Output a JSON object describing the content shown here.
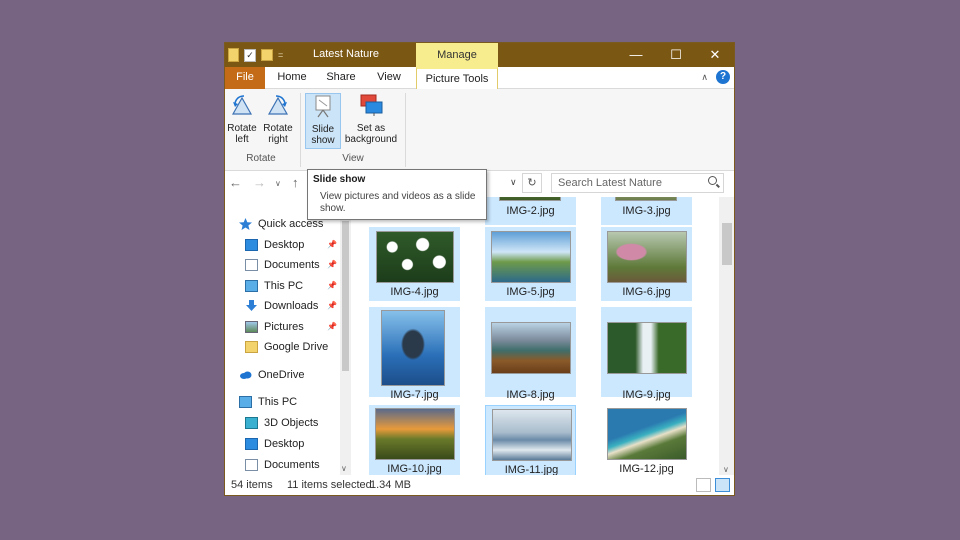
{
  "window": {
    "title": "Latest Nature"
  },
  "titlebar": {
    "manage_label": "Manage",
    "minimize": "—",
    "maximize": "☐",
    "close": "✕",
    "sep": "="
  },
  "tabs": {
    "file": "File",
    "home": "Home",
    "share": "Share",
    "view": "View",
    "picture_tools": "Picture Tools"
  },
  "ribbon": {
    "rotate_left": [
      "Rotate",
      "left"
    ],
    "rotate_right": [
      "Rotate",
      "right"
    ],
    "slide_show": [
      "Slide",
      "show"
    ],
    "set_background": [
      "Set as",
      "background"
    ],
    "group_rotate": "Rotate",
    "group_view": "View"
  },
  "tooltip": {
    "title": "Slide show",
    "text": "View pictures and videos as a slide show."
  },
  "address": {
    "search_placeholder": "Search Latest Nature"
  },
  "nav": {
    "quick_access": "Quick access",
    "desktop": "Desktop",
    "documents": "Documents",
    "this_pc_qa": "This PC",
    "downloads": "Downloads",
    "pictures": "Pictures",
    "google_drive": "Google Drive",
    "onedrive": "OneDrive",
    "this_pc": "This PC",
    "objects_3d": "3D Objects",
    "desktop2": "Desktop",
    "documents2": "Documents"
  },
  "files": [
    {
      "name": "IMG-2.jpg",
      "selected": true
    },
    {
      "name": "IMG-3.jpg",
      "selected": true
    },
    {
      "name": "IMG-4.jpg",
      "selected": true
    },
    {
      "name": "IMG-5.jpg",
      "selected": true
    },
    {
      "name": "IMG-6.jpg",
      "selected": true
    },
    {
      "name": "IMG-7.jpg",
      "selected": true
    },
    {
      "name": "IMG-8.jpg",
      "selected": true
    },
    {
      "name": "IMG-9.jpg",
      "selected": true
    },
    {
      "name": "IMG-10.jpg",
      "selected": true
    },
    {
      "name": "IMG-11.jpg",
      "selected": true
    },
    {
      "name": "IMG-12.jpg",
      "selected": false
    }
  ],
  "status": {
    "item_count": "54 items",
    "selected_count": "11 items selected",
    "selected_size": "1.34 MB"
  }
}
